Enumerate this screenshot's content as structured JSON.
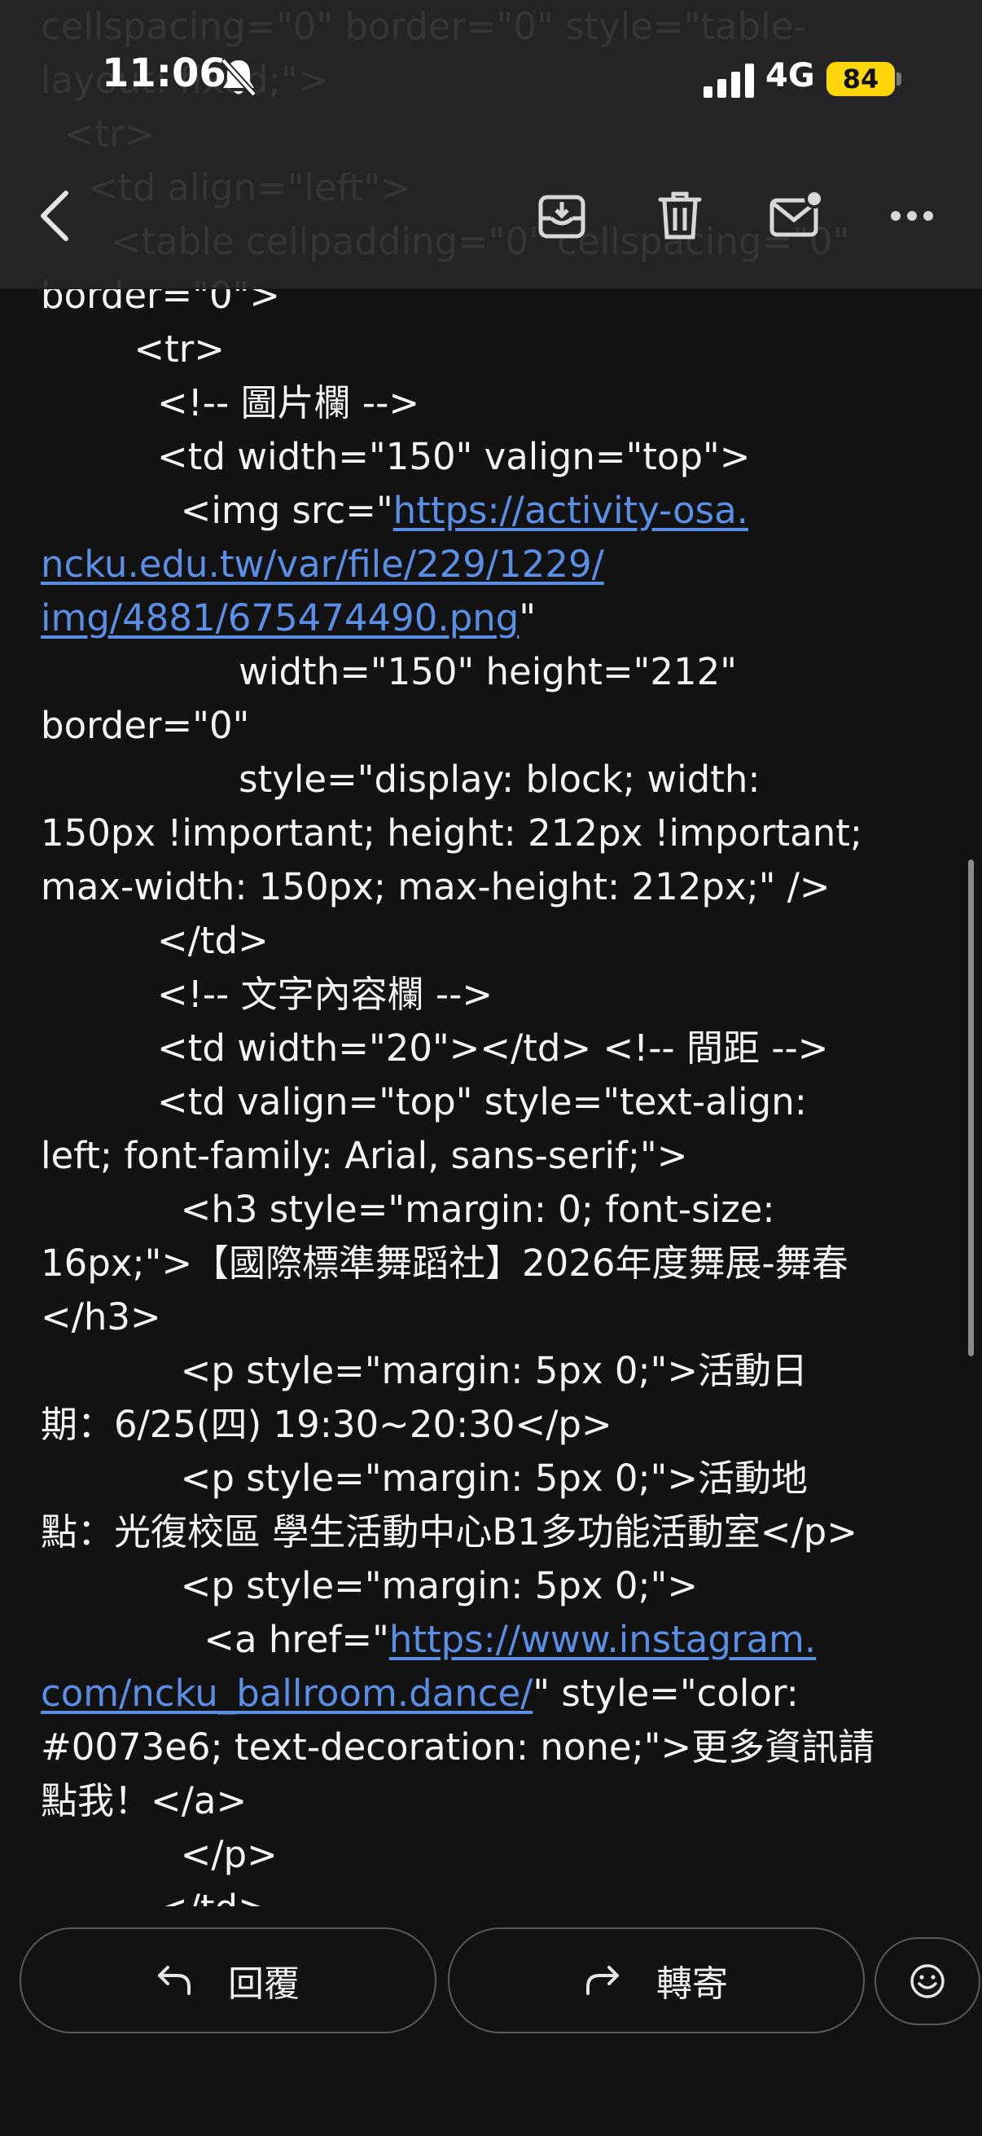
{
  "status_bar": {
    "time": "11:06",
    "network": "4G",
    "battery": "84"
  },
  "toolbar": {
    "icons": [
      "chevron-left-icon",
      "archive-icon",
      "trash-icon",
      "mark-unread-icon",
      "more-icon"
    ]
  },
  "source_lines": [
    {
      "text": "cellspacing=\"0\" border=\"0\" style=\"table-"
    },
    {
      "text": "layout: fixed;\">"
    },
    {
      "text": "  <tr>"
    },
    {
      "text": "    <td align=\"left\">"
    },
    {
      "text": "      <table cellpadding=\"0\" cellspacing=\"0\""
    },
    {
      "text": "border=\"0\">"
    },
    {
      "text": "        <tr>"
    },
    {
      "text": "          <!-- 圖片欄 -->"
    },
    {
      "text": "          <td width=\"150\" valign=\"top\">"
    },
    {
      "text": "            <img src=\"",
      "link": "https://activity-osa."
    },
    {
      "link": "ncku.edu.tw/var/file/229/1229/"
    },
    {
      "link": "img/4881/675474490.png",
      "text_after": "\""
    },
    {
      "text": "                 width=\"150\" height=\"212\""
    },
    {
      "text": "border=\"0\""
    },
    {
      "text": "                 style=\"display: block; width:"
    },
    {
      "text": "150px !important; height: 212px !important;"
    },
    {
      "text": "max-width: 150px; max-height: 212px;\" />"
    },
    {
      "text": "          </td>"
    },
    {
      "text": "          <!-- 文字內容欄 -->"
    },
    {
      "text": "          <td width=\"20\"></td> <!-- 間距 -->"
    },
    {
      "text": "          <td valign=\"top\" style=\"text-align:"
    },
    {
      "text": "left; font-family: Arial, sans-serif;\">"
    },
    {
      "text": "            <h3 style=\"margin: 0; font-size:"
    },
    {
      "text": "16px;\">【國際標準舞蹈社】2026年度舞展-舞春"
    },
    {
      "text": "</h3>"
    },
    {
      "text": "            <p style=\"margin: 5px 0;\">活動日"
    },
    {
      "text": "期：6/25(四) 19:30~20:30</p>"
    },
    {
      "text": "            <p style=\"margin: 5px 0;\">活動地"
    },
    {
      "text": "點：光復校區 學生活動中心B1多功能活動室</p>"
    },
    {
      "text": "            <p style=\"margin: 5px 0;\">"
    },
    {
      "text": "              <a href=\"",
      "link": "https://www.instagram."
    },
    {
      "link": "com/ncku_ballroom.dance/",
      "text_after": "\" style=\"color:"
    },
    {
      "text": "#0073e6; text-decoration: none;\">更多資訊請"
    },
    {
      "text": "點我！</a>"
    },
    {
      "text": "            </p>"
    },
    {
      "text": "          </td>"
    }
  ],
  "bottom_bar": {
    "reply_label": "回覆",
    "forward_label": "轉寄"
  }
}
